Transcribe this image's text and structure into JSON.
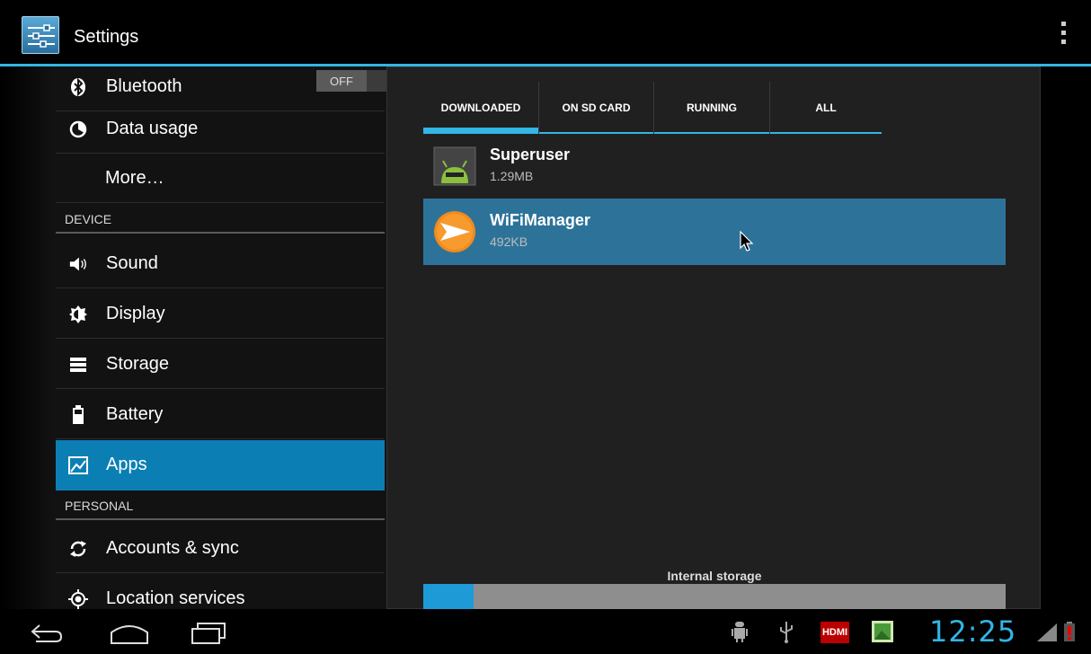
{
  "actionbar": {
    "title": "Settings"
  },
  "sidebar": {
    "items": [
      {
        "label": "Bluetooth",
        "toggle": "OFF"
      },
      {
        "label": "Data usage"
      },
      {
        "label": "More…"
      },
      {
        "header": "DEVICE"
      },
      {
        "label": "Sound"
      },
      {
        "label": "Display"
      },
      {
        "label": "Storage"
      },
      {
        "label": "Battery"
      },
      {
        "label": "Apps",
        "selected": true
      },
      {
        "header": "PERSONAL"
      },
      {
        "label": "Accounts & sync"
      },
      {
        "label": "Location services"
      }
    ]
  },
  "tabs": [
    {
      "label": "DOWNLOADED",
      "selected": true
    },
    {
      "label": "ON SD CARD"
    },
    {
      "label": "RUNNING"
    },
    {
      "label": "ALL"
    }
  ],
  "apps": [
    {
      "name": "Superuser",
      "size": "1.29MB",
      "icon": "android-icon"
    },
    {
      "name": "WiFiManager",
      "size": "492KB",
      "icon": "wifi-manager-icon",
      "selected": true
    }
  ],
  "storage": {
    "label": "Internal storage",
    "used_fraction": 0.087
  },
  "statusbar": {
    "time": "12:25",
    "hdmi_label": "HDMI"
  },
  "colors": {
    "accent": "#33b5e5",
    "selected_row": "#0b7fb4",
    "selected_app": "#2d7399"
  }
}
